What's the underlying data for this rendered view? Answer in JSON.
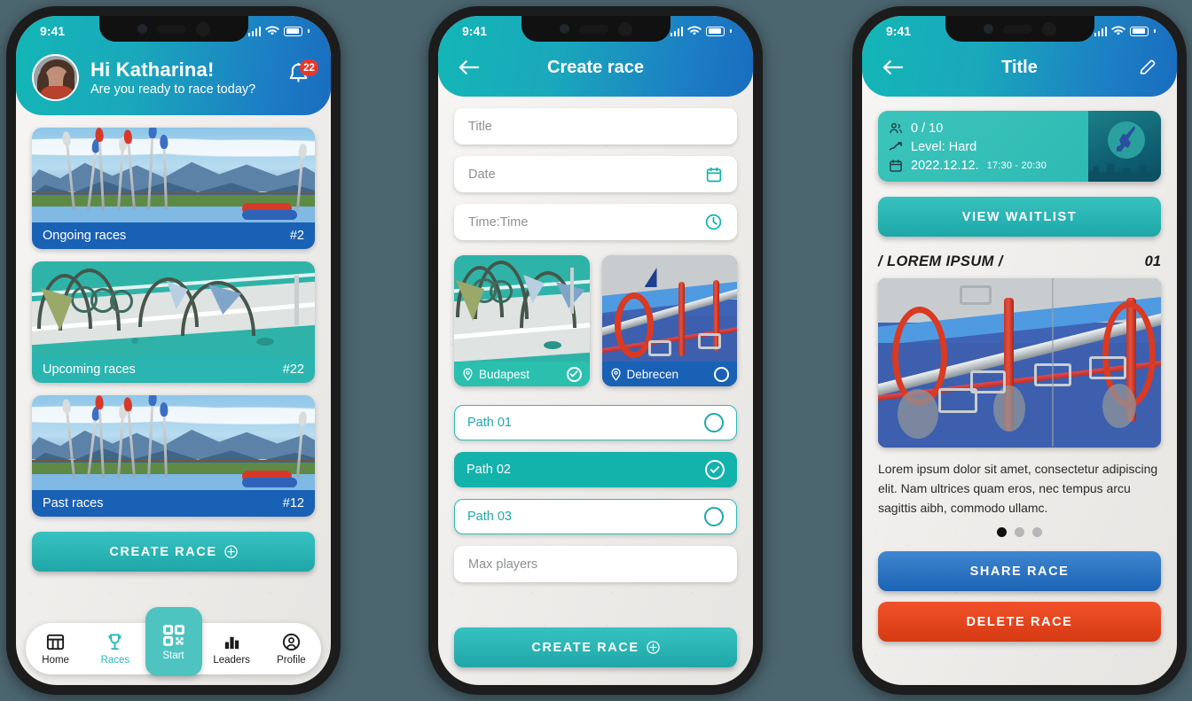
{
  "colors": {
    "page_bg": "#4c6670",
    "accent_teal": "#2bb8b8",
    "accent_blue": "#1961b4",
    "danger_red": "#e8382b",
    "header_gradient_from": "#13b6b6",
    "header_gradient_to": "#1a6cc0"
  },
  "status_bar": {
    "time": "9:41",
    "signal_icon": "signal-bars-icon",
    "wifi_icon": "wifi-icon",
    "battery_icon": "battery-icon"
  },
  "phone1": {
    "header": {
      "avatar": "user-avatar",
      "greeting": "Hi Katharina!",
      "subtitle": "Are you ready to race today?",
      "bell_icon": "notification-bell-icon",
      "badge_count": "22"
    },
    "cards": [
      {
        "label": "Ongoing races",
        "count": "#2",
        "bar_color": "blue",
        "scene": "mountain"
      },
      {
        "label": "Upcoming races",
        "count": "#22",
        "bar_color": "teal",
        "scene": "aqua"
      },
      {
        "label": "Past races",
        "count": "#12",
        "bar_color": "blue",
        "scene": "mountain"
      }
    ],
    "create_button": {
      "label": "CREATE RACE",
      "icon": "plus-circle-icon"
    },
    "tabs": [
      {
        "label": "Home",
        "icon": "home-grid-icon",
        "active": false
      },
      {
        "label": "Races",
        "icon": "trophy-icon",
        "active": true
      },
      {
        "label": "Start",
        "icon": "qr-code-icon",
        "active": false,
        "highlighted": true
      },
      {
        "label": "Leaders",
        "icon": "bar-chart-icon",
        "active": false
      },
      {
        "label": "Profile",
        "icon": "profile-circle-icon",
        "active": false
      }
    ]
  },
  "phone2": {
    "header": {
      "back_icon": "arrow-left-icon",
      "title": "Create race"
    },
    "fields": [
      {
        "placeholder": "Title",
        "icon": ""
      },
      {
        "placeholder": "Date",
        "icon": "calendar-icon"
      },
      {
        "placeholder": "Time:Time",
        "icon": "clock-icon"
      },
      {
        "placeholder": "Max players",
        "icon": ""
      }
    ],
    "locations": [
      {
        "name": "Budapest",
        "selected": true,
        "pin_icon": "map-pin-icon"
      },
      {
        "name": "Debrecen",
        "selected": false,
        "pin_icon": "map-pin-icon"
      }
    ],
    "paths": [
      {
        "label": "Path 01",
        "selected": false
      },
      {
        "label": "Path 02",
        "selected": true
      },
      {
        "label": "Path 03",
        "selected": false
      }
    ],
    "create_button": {
      "label": "CREATE RACE",
      "icon": "plus-circle-icon"
    }
  },
  "phone3": {
    "header": {
      "back_icon": "arrow-left-icon",
      "title": "Title",
      "edit_icon": "pencil-edit-icon"
    },
    "info": {
      "players_icon": "people-icon",
      "players": "0 / 10",
      "level_icon": "trend-up-icon",
      "level": "Level: Hard",
      "date_icon": "calendar-icon",
      "date": "2022.12.12.",
      "time_range": "17:30 - 20:30"
    },
    "waitlist_button": {
      "label": "VIEW WAITLIST"
    },
    "section": {
      "title": "/ LOREM IPSUM /",
      "number": "01"
    },
    "description": "Lorem ipsum dolor sit amet, consectetur adipiscing elit. Nam ultrices quam eros, nec tempus arcu sagittis aibh, commodo ullamc.",
    "carousel": {
      "total": 3,
      "active_index": 0
    },
    "share_button": {
      "label": "SHARE RACE"
    },
    "delete_button": {
      "label": "DELETE RACE"
    }
  }
}
